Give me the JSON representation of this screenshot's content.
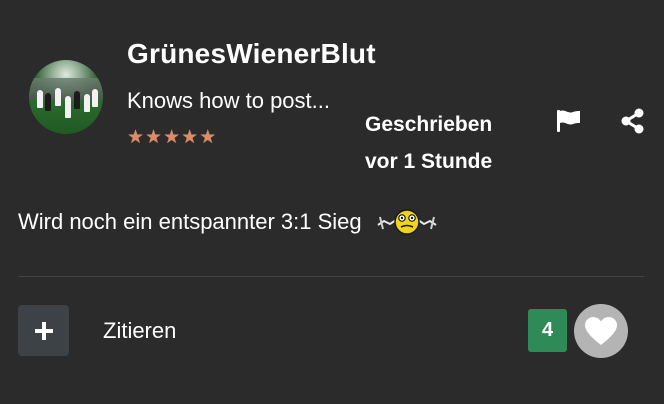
{
  "post": {
    "username": "GrünesWienerBlut",
    "rank": "Knows how to post...",
    "star_rating": 5,
    "stars": [
      "★",
      "★",
      "★",
      "★",
      "★"
    ],
    "posted_line1": "Geschrieben",
    "posted_line2": "vor 1 Stunde",
    "content": "Wird noch ein entspannter 3:1 Sieg",
    "like_count": "4",
    "quote_label": "Zitieren",
    "plus_symbol": "+"
  },
  "icons": {
    "flag": "flag-icon",
    "share": "share-icon",
    "heart": "heart-icon",
    "plus": "plus-icon",
    "smiley": "smiley-emoticon"
  },
  "colors": {
    "background": "#2b2b2b",
    "text": "#ffffff",
    "star": "#d98e6b",
    "like_badge": "#2e8b57",
    "like_button": "#b4b4b4",
    "button_dark": "#3c4246",
    "divider": "#444444"
  }
}
